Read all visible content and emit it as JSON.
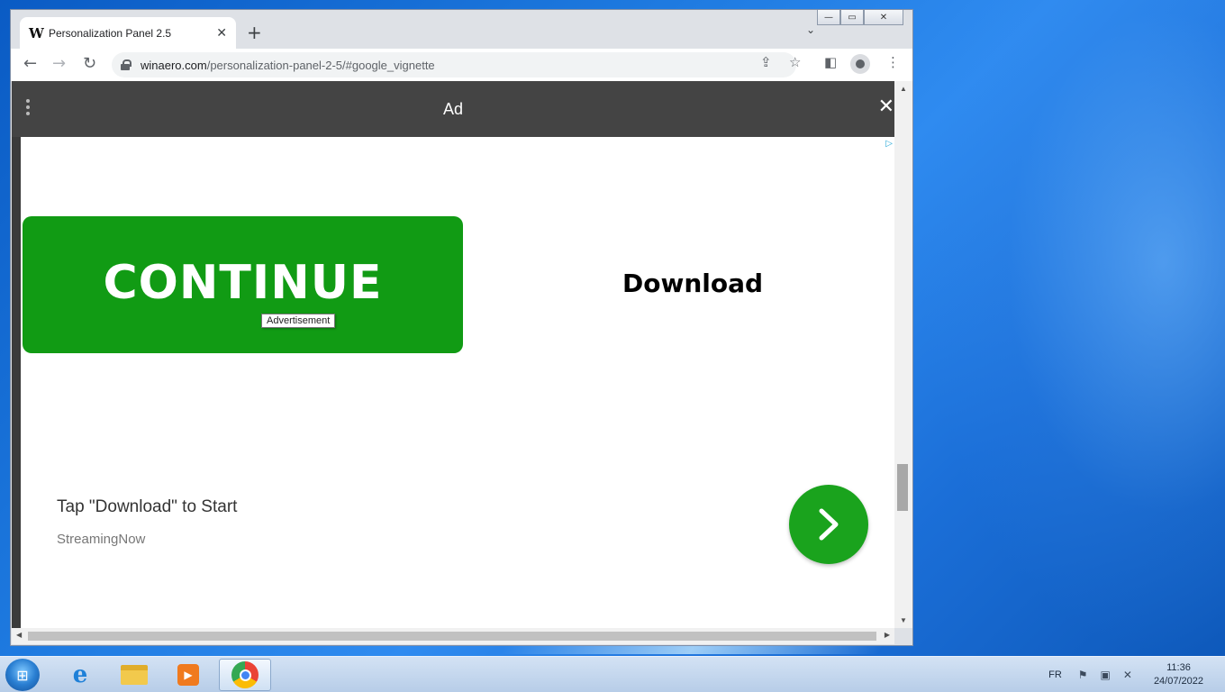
{
  "browser": {
    "tab": {
      "favicon": "W",
      "title": "Personalization Panel 2.5"
    },
    "new_tab": "+",
    "tab_search": "⌄",
    "window_controls": {
      "minimize": "—",
      "maximize": "▭",
      "close": "✕"
    },
    "nav": {
      "back": "←",
      "forward": "→",
      "reload": "↻"
    },
    "url_host": "winaero.com",
    "url_path": "/personalization-panel-2-5/#google_vignette",
    "icons": {
      "share": "⇪",
      "bookmark": "☆",
      "sidepanel": "◧",
      "menu": "⋮"
    }
  },
  "ad": {
    "header_label": "Ad",
    "close": "✕",
    "adchoices": "▷",
    "continue_label": "CONTINUE",
    "tooltip": "Advertisement",
    "download_label": "Download",
    "tagline": "Tap \"Download\" to Start",
    "advertiser": "StreamingNow",
    "go_arrow": "›"
  },
  "scrollbars": {
    "up": "▲",
    "down": "▼",
    "left": "◀",
    "right": "▶"
  },
  "taskbar": {
    "start_icon": "⊞",
    "ie_icon": "e",
    "media_icon": "▶",
    "language": "FR",
    "tray_icons": [
      "⚑",
      "▣",
      "✕"
    ],
    "time": "11:36",
    "date": "24/07/2022"
  },
  "colors": {
    "accent_green": "#119b14",
    "ad_bar": "#444444",
    "taskbar": "#c4d7ee"
  }
}
